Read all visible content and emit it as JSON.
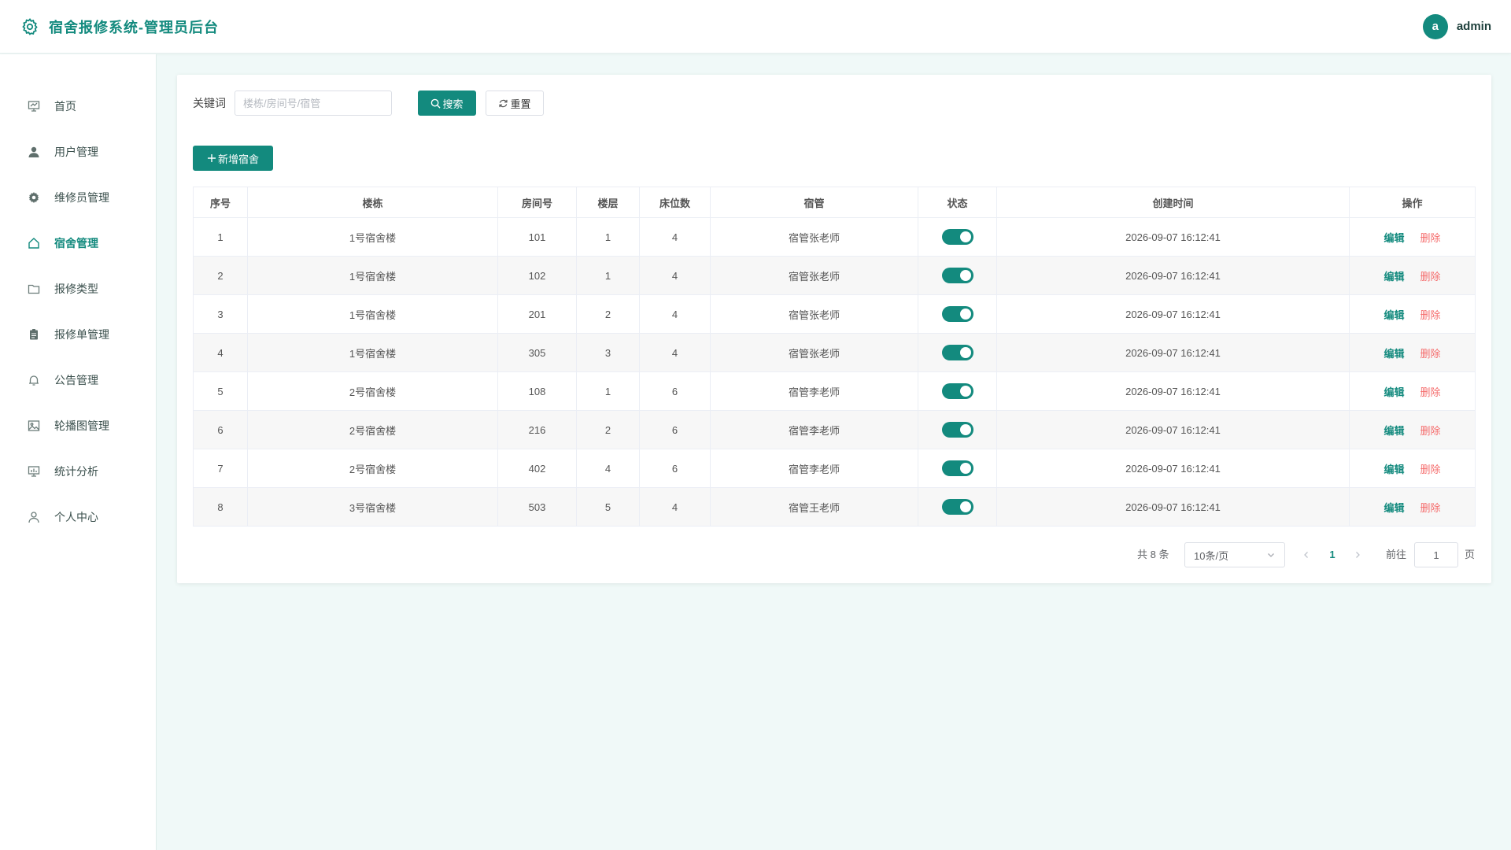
{
  "header": {
    "title": "宿舍报修系统-管理员后台",
    "logo_icon": "gear-icon",
    "user": {
      "avatar_letter": "a",
      "name": "admin"
    }
  },
  "colors": {
    "primary": "#138a7e",
    "danger": "#f56c6c",
    "background": "#f0f9f8"
  },
  "sidebar": {
    "active": "宿舍管理",
    "items": [
      {
        "label": "首页",
        "icon": "presentation-chart-icon"
      },
      {
        "label": "用户管理",
        "icon": "user-icon"
      },
      {
        "label": "维修员管理",
        "icon": "gear-icon"
      },
      {
        "label": "宿舍管理",
        "icon": "house-icon"
      },
      {
        "label": "报修类型",
        "icon": "folder-icon"
      },
      {
        "label": "报修单管理",
        "icon": "clipboard-icon"
      },
      {
        "label": "公告管理",
        "icon": "bell-icon"
      },
      {
        "label": "轮播图管理",
        "icon": "picture-icon"
      },
      {
        "label": "统计分析",
        "icon": "chart-board-icon"
      },
      {
        "label": "个人中心",
        "icon": "user-outline-icon"
      }
    ]
  },
  "search": {
    "label": "关键词",
    "placeholder": "楼栋/房间号/宿管",
    "value": "",
    "search_button": "搜索",
    "reset_button": "重置"
  },
  "add_button": "新增宿舍",
  "table": {
    "headers": [
      "序号",
      "楼栋",
      "房间号",
      "楼层",
      "床位数",
      "宿管",
      "状态",
      "创建时间",
      "操作"
    ],
    "edit_label": "编辑",
    "delete_label": "删除",
    "rows": [
      {
        "index": "1",
        "building": "1号宿舍楼",
        "room": "101",
        "floor": "1",
        "beds": "4",
        "manager": "宿管张老师",
        "status": true,
        "created": "2026-09-07 16:12:41"
      },
      {
        "index": "2",
        "building": "1号宿舍楼",
        "room": "102",
        "floor": "1",
        "beds": "4",
        "manager": "宿管张老师",
        "status": true,
        "created": "2026-09-07 16:12:41"
      },
      {
        "index": "3",
        "building": "1号宿舍楼",
        "room": "201",
        "floor": "2",
        "beds": "4",
        "manager": "宿管张老师",
        "status": true,
        "created": "2026-09-07 16:12:41"
      },
      {
        "index": "4",
        "building": "1号宿舍楼",
        "room": "305",
        "floor": "3",
        "beds": "4",
        "manager": "宿管张老师",
        "status": true,
        "created": "2026-09-07 16:12:41"
      },
      {
        "index": "5",
        "building": "2号宿舍楼",
        "room": "108",
        "floor": "1",
        "beds": "6",
        "manager": "宿管李老师",
        "status": true,
        "created": "2026-09-07 16:12:41"
      },
      {
        "index": "6",
        "building": "2号宿舍楼",
        "room": "216",
        "floor": "2",
        "beds": "6",
        "manager": "宿管李老师",
        "status": true,
        "created": "2026-09-07 16:12:41"
      },
      {
        "index": "7",
        "building": "2号宿舍楼",
        "room": "402",
        "floor": "4",
        "beds": "6",
        "manager": "宿管李老师",
        "status": true,
        "created": "2026-09-07 16:12:41"
      },
      {
        "index": "8",
        "building": "3号宿舍楼",
        "room": "503",
        "floor": "5",
        "beds": "4",
        "manager": "宿管王老师",
        "status": true,
        "created": "2026-09-07 16:12:41"
      }
    ]
  },
  "pagination": {
    "total_text": "共 8 条",
    "page_size": "10条/页",
    "current_page": "1",
    "goto_label": "前往",
    "goto_value": "1",
    "page_unit": "页"
  }
}
